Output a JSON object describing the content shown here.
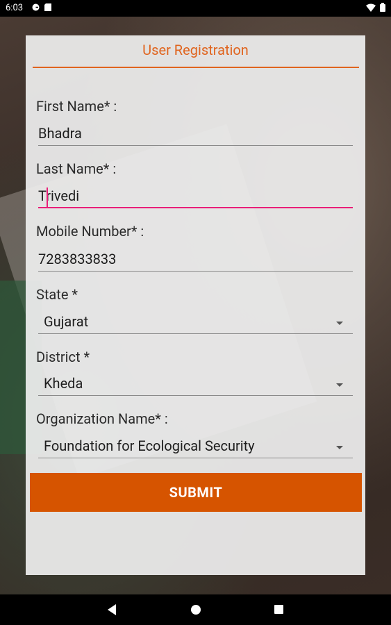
{
  "status_bar": {
    "time": "6:03",
    "left_icons": [
      "google-icon",
      "sd-card-icon"
    ],
    "right_icons": [
      "wifi-icon",
      "battery-icon"
    ]
  },
  "form": {
    "title": "User Registration",
    "accent_color": "#e0641e",
    "focus_color": "#e91e78",
    "fields": {
      "first_name": {
        "label": "First Name* :",
        "value": "Bhadra"
      },
      "last_name": {
        "label": "Last Name* :",
        "value": "Trivedi",
        "focused": true
      },
      "mobile": {
        "label": "Mobile Number* :",
        "value": "7283833833"
      },
      "state": {
        "label": "State *",
        "value": "Gujarat"
      },
      "district": {
        "label": "District *",
        "value": "Kheda"
      },
      "organization": {
        "label": "Organization Name* :",
        "value": "Foundation for Ecological Security"
      }
    },
    "submit_label": "SUBMIT",
    "submit_color": "#d65400"
  },
  "nav_bar": {
    "buttons": [
      "back-icon",
      "home-icon",
      "recents-icon"
    ]
  }
}
